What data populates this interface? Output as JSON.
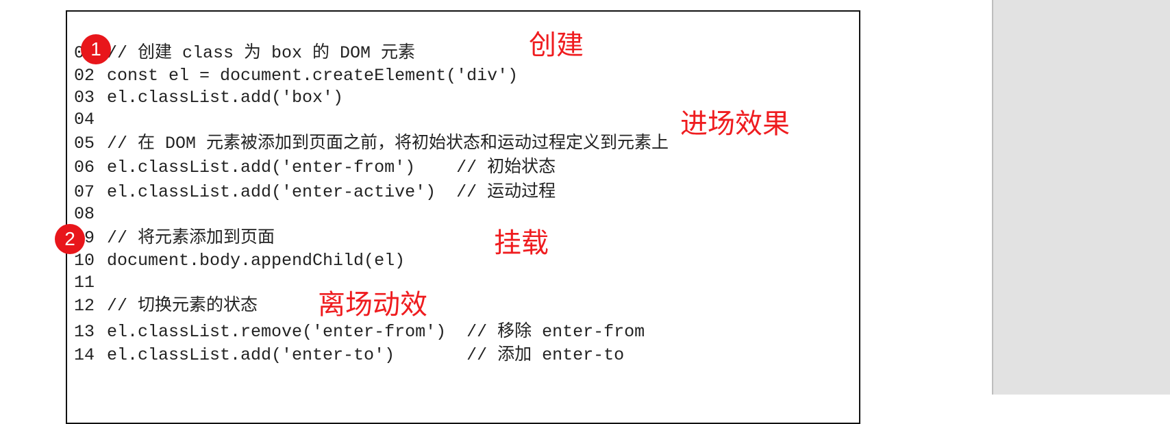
{
  "code_lines": [
    {
      "num": "01",
      "text": "// 创建 class 为 box 的 DOM 元素"
    },
    {
      "num": "02",
      "text": "const el = document.createElement('div')"
    },
    {
      "num": "03",
      "text": "el.classList.add('box')"
    },
    {
      "num": "04",
      "text": ""
    },
    {
      "num": "05",
      "text": "// 在 DOM 元素被添加到页面之前，将初始状态和运动过程定义到元素上"
    },
    {
      "num": "06",
      "text": "el.classList.add('enter-from')    // 初始状态"
    },
    {
      "num": "07",
      "text": "el.classList.add('enter-active')  // 运动过程"
    },
    {
      "num": "08",
      "text": ""
    },
    {
      "num": "09",
      "text": "// 将元素添加到页面"
    },
    {
      "num": "10",
      "text": "document.body.appendChild(el)"
    },
    {
      "num": "11",
      "text": ""
    },
    {
      "num": "12",
      "text": "// 切换元素的状态"
    },
    {
      "num": "13",
      "text": "el.classList.remove('enter-from')  // 移除 enter-from"
    },
    {
      "num": "14",
      "text": "el.classList.add('enter-to')       // 添加 enter-to"
    }
  ],
  "markers": [
    "1",
    "2"
  ],
  "annotations": {
    "create": "创建",
    "enter_effect": "进场效果",
    "mount": "挂载",
    "leave_effect": "离场动效"
  },
  "colors": {
    "annotation": "#ef1c1f",
    "marker": "#e8161b"
  }
}
